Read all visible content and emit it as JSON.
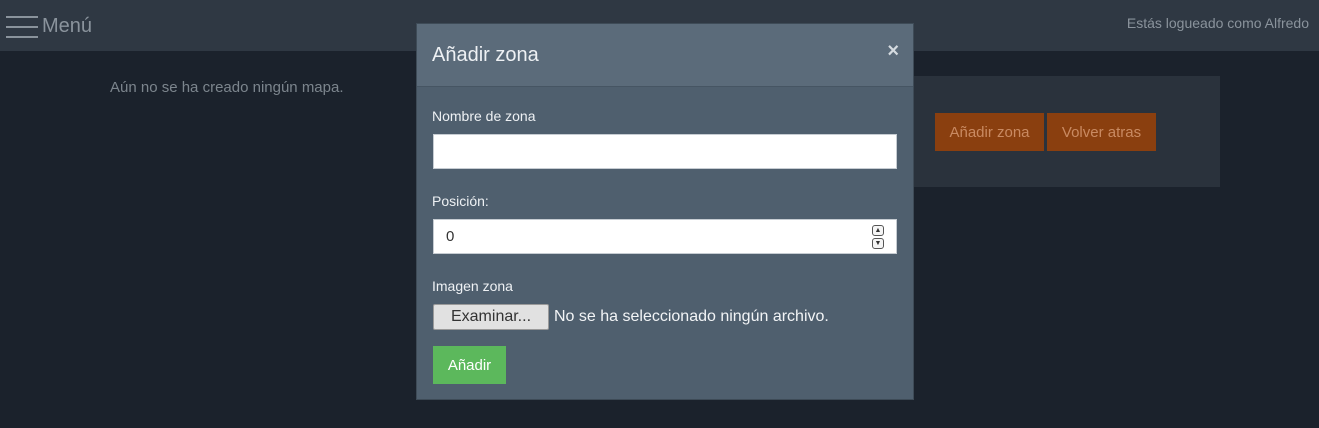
{
  "navbar": {
    "menu_label": "Menú",
    "login_status": "Estás logueado como Alfredo"
  },
  "content": {
    "empty_message": "Aún no se ha creado ningún mapa.",
    "add_zone_button": "Añadir zona",
    "back_button": "Volver atras"
  },
  "modal": {
    "title": "Añadir zona",
    "close_symbol": "×",
    "name_label": "Nombre de zona",
    "name_value": "",
    "position_label": "Posición:",
    "position_value": "0",
    "image_label": "Imagen zona",
    "browse_button": "Examinar...",
    "file_status": "No se ha seleccionado ningún archivo.",
    "submit_button": "Añadir"
  },
  "colors": {
    "accent_orange": "#8a3f0f",
    "submit_green": "#5cb85c",
    "modal_bg": "#4f5f6e",
    "page_bg": "#1b222c"
  }
}
